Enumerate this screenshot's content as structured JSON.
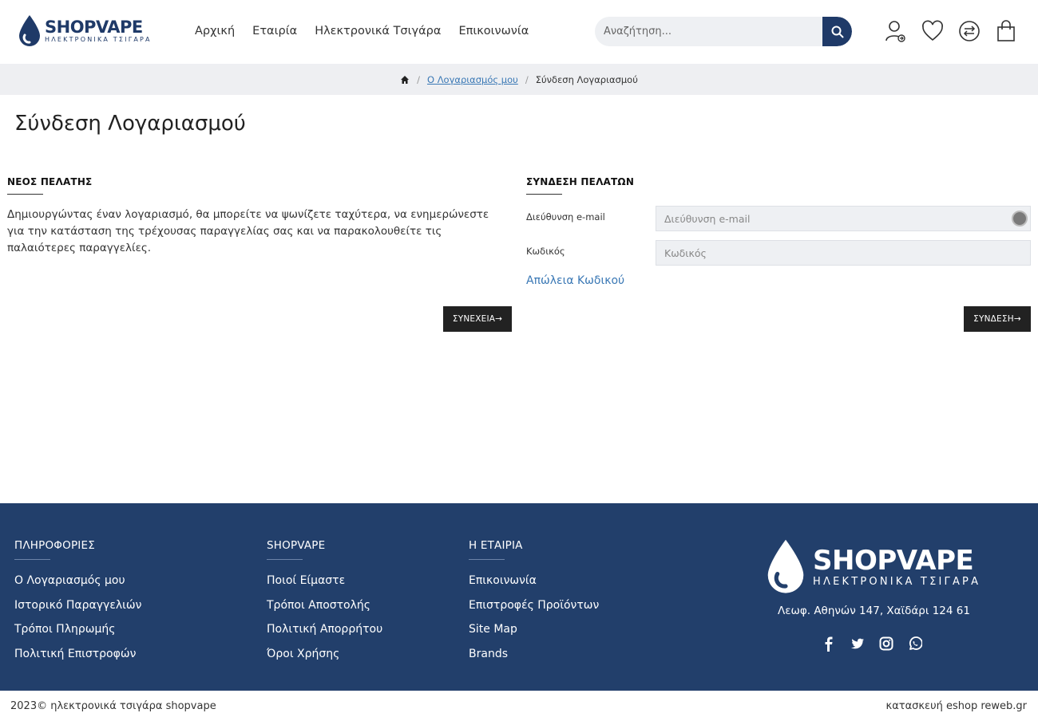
{
  "header": {
    "logo_name": "SHOPVAPE",
    "logo_sub": "ΗΛΕΚΤΡΟΝΙΚΑ ΤΣΙΓΑΡΑ",
    "nav": [
      "Αρχική",
      "Εταιρία",
      "Ηλεκτρονικά Τσιγάρα",
      "Επικοινωνία"
    ],
    "search_placeholder": "Αναζήτηση...",
    "icons": [
      "account-icon",
      "wishlist-icon",
      "compare-icon",
      "cart-icon"
    ]
  },
  "breadcrumb": {
    "home_icon": "home-icon",
    "account": "Ο Λογαριασμός μου",
    "current": "Σύνδεση Λογαριασμού"
  },
  "page_title": "Σύνδεση Λογαριασμού",
  "new_customer": {
    "heading": "ΝΕΟΣ ΠΕΛΑΤΗΣ",
    "text": "Δημιουργώντας έναν λογαριασμό, θα μπορείτε να ψωνίζετε ταχύτερα, να ενημερώνεστε για την κατάσταση της τρέχουσας παραγγελίας σας και να παρακολουθείτε τις παλαιότερες παραγγελίες.",
    "continue_label": "ΣΥΝΕΧΕΙΑ→"
  },
  "login": {
    "heading": "ΣΥΝΔΕΣΗ ΠΕΛΑΤΩΝ",
    "email_label": "Διεύθυνση e-mail",
    "email_placeholder": "Διεύθυνση e-mail",
    "password_label": "Κωδικός",
    "password_placeholder": "Κωδικός",
    "lost_password": "Απώλεια Κωδικού",
    "login_label": "ΣΥΝΔΕΣΗ→"
  },
  "footer": {
    "col1": {
      "heading": "ΠΛΗΡΟΦΟΡΙΕΣ",
      "items": [
        "Ο Λογαριασμός μου",
        "Ιστορικό Παραγγελιών",
        "Τρόποι Πληρωμής",
        "Πολιτική Επιστροφών"
      ]
    },
    "col2": {
      "heading": "SHOPVAPE",
      "items": [
        "Ποιοί Είμαστε",
        "Τρόποι Αποστολής",
        "Πολιτική Απορρήτου",
        "Όροι Χρήσης"
      ]
    },
    "col3": {
      "heading": "Η ΕΤΑΙΡΙΑ",
      "items": [
        "Επικοινωνία",
        "Επιστροφές Προϊόντων",
        "Site Map",
        "Brands"
      ]
    },
    "logo_name": "SHOPVAPE",
    "logo_sub": "ΗΛΕΚΤΡΟΝΙΚΑ ΤΣΙΓΑΡΑ",
    "address": "Λεωφ. Αθηνών 147, Χαϊδάρι 124 61",
    "social": [
      "facebook-icon",
      "twitter-icon",
      "instagram-icon",
      "whatsapp-icon"
    ]
  },
  "bottom": {
    "copyright": "2023© ηλεκτρονικά τσιγάρα shopvape",
    "credit": "κατασκευή eshop reweb.gr"
  },
  "colors": {
    "brand": "#1f3a68",
    "footer": "#223f6b",
    "link": "#3a78b5"
  }
}
